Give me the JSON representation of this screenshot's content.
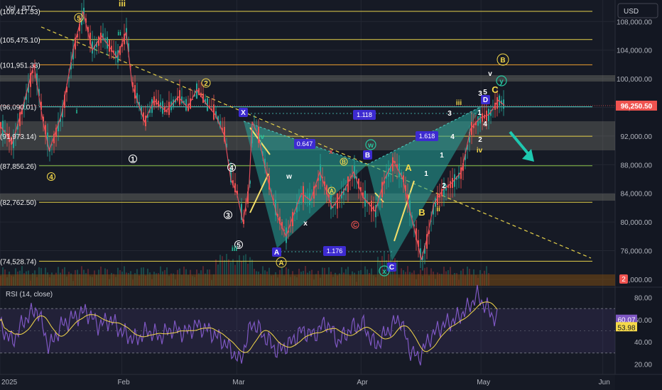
{
  "header": {
    "vol_label": "Vol · BTC",
    "currency_button": "USD"
  },
  "chart_data": [
    {
      "type": "line",
      "panel": "price",
      "x_ticks": [
        "2025",
        "Feb",
        "Mar",
        "Apr",
        "May",
        "Jun"
      ],
      "y_ticks": [
        72000,
        76000,
        80000,
        84000,
        88000,
        92000,
        96000,
        100000,
        104000,
        108000
      ],
      "ylim": [
        71000,
        111000
      ],
      "current_price": "96,250.50",
      "current_price_value": 96250.5,
      "countdown_badge": "2",
      "horizontal_levels": [
        {
          "label": "(109,417.53)",
          "value": 109417.53
        },
        {
          "label": "(105,475.10)",
          "value": 105475.1
        },
        {
          "label": "(101,951.33)",
          "value": 101951.33
        },
        {
          "label": "(96,090.01)",
          "value": 96090.01
        },
        {
          "label": "(91,973.14)",
          "value": 91973.14
        },
        {
          "label": "(87,856.26)",
          "value": 87856.26
        },
        {
          "label": "(82,762.50)",
          "value": 82762.5
        },
        {
          "label": "(74,528.74)",
          "value": 74528.74
        }
      ],
      "price_path": [
        [
          0,
          93500
        ],
        [
          0.02,
          91000
        ],
        [
          0.04,
          97000
        ],
        [
          0.055,
          102000
        ],
        [
          0.07,
          94000
        ],
        [
          0.08,
          90000
        ],
        [
          0.1,
          95000
        ],
        [
          0.12,
          104500
        ],
        [
          0.135,
          109400
        ],
        [
          0.15,
          104000
        ],
        [
          0.165,
          106000
        ],
        [
          0.19,
          103000
        ],
        [
          0.205,
          106500
        ],
        [
          0.215,
          99000
        ],
        [
          0.225,
          96500
        ],
        [
          0.235,
          94000
        ],
        [
          0.25,
          97000
        ],
        [
          0.27,
          95500
        ],
        [
          0.29,
          97500
        ],
        [
          0.305,
          96000
        ],
        [
          0.32,
          98500
        ],
        [
          0.335,
          96500
        ],
        [
          0.35,
          95000
        ],
        [
          0.365,
          92000
        ],
        [
          0.375,
          86000
        ],
        [
          0.385,
          84000
        ],
        [
          0.395,
          80000
        ],
        [
          0.405,
          85000
        ],
        [
          0.41,
          94000
        ],
        [
          0.42,
          92000
        ],
        [
          0.435,
          86000
        ],
        [
          0.45,
          81000
        ],
        [
          0.465,
          78000
        ],
        [
          0.475,
          80500
        ],
        [
          0.49,
          84000
        ],
        [
          0.505,
          83000
        ],
        [
          0.52,
          87000
        ],
        [
          0.54,
          82000
        ],
        [
          0.56,
          84500
        ],
        [
          0.575,
          87000
        ],
        [
          0.59,
          83500
        ],
        [
          0.61,
          81500
        ],
        [
          0.625,
          86000
        ],
        [
          0.64,
          88500
        ],
        [
          0.655,
          86000
        ],
        [
          0.665,
          82000
        ],
        [
          0.675,
          78500
        ],
        [
          0.685,
          74700
        ],
        [
          0.695,
          78000
        ],
        [
          0.705,
          82500
        ],
        [
          0.72,
          84500
        ],
        [
          0.735,
          85500
        ],
        [
          0.75,
          87000
        ],
        [
          0.765,
          93000
        ],
        [
          0.78,
          94500
        ],
        [
          0.795,
          95000
        ],
        [
          0.81,
          97000
        ],
        [
          0.82,
          96300
        ]
      ],
      "annotations": {
        "fib_ratios": [
          "1.118",
          "0.647",
          "1.618",
          "1.176"
        ],
        "pattern_points": [
          "X",
          "A",
          "B",
          "C",
          "D"
        ],
        "waves_yellow_circled": [
          "5",
          "4",
          "1",
          "2",
          "3",
          "4",
          "3",
          "4",
          "5",
          "A",
          "B",
          "C",
          "w",
          "y",
          "x",
          "B"
        ],
        "waves_plain": [
          "iii",
          "ii",
          "i",
          "iv",
          "w",
          "x",
          "iii",
          "iv",
          "v",
          "i",
          "ii",
          "1",
          "2",
          "3",
          "4",
          "5",
          "B",
          "C",
          "A",
          "y",
          "x",
          "v"
        ],
        "roman_counts": [
          "iii",
          "ii",
          "i",
          "iv",
          "iii",
          "ii",
          "iv"
        ],
        "arabic_counts": [
          "1",
          "2",
          "3",
          "4",
          "5"
        ]
      }
    },
    {
      "type": "line",
      "panel": "rsi",
      "title": "RSI (14, close)",
      "y_ticks": [
        20,
        40,
        60,
        80
      ],
      "ylim": [
        12,
        88
      ],
      "band": [
        30,
        70
      ],
      "rsi_value": "60.07",
      "rsi_ma_value": "53.98",
      "rsi_path": [
        [
          0,
          55
        ],
        [
          0.02,
          40
        ],
        [
          0.04,
          60
        ],
        [
          0.06,
          70
        ],
        [
          0.08,
          35
        ],
        [
          0.1,
          55
        ],
        [
          0.12,
          62
        ],
        [
          0.14,
          68
        ],
        [
          0.16,
          55
        ],
        [
          0.18,
          60
        ],
        [
          0.2,
          48
        ],
        [
          0.22,
          42
        ],
        [
          0.24,
          50
        ],
        [
          0.26,
          45
        ],
        [
          0.28,
          52
        ],
        [
          0.3,
          48
        ],
        [
          0.32,
          55
        ],
        [
          0.34,
          50
        ],
        [
          0.36,
          42
        ],
        [
          0.38,
          30
        ],
        [
          0.39,
          22
        ],
        [
          0.41,
          58
        ],
        [
          0.43,
          45
        ],
        [
          0.45,
          32
        ],
        [
          0.47,
          38
        ],
        [
          0.49,
          50
        ],
        [
          0.51,
          46
        ],
        [
          0.53,
          58
        ],
        [
          0.55,
          40
        ],
        [
          0.57,
          52
        ],
        [
          0.59,
          56
        ],
        [
          0.61,
          36
        ],
        [
          0.63,
          50
        ],
        [
          0.65,
          62
        ],
        [
          0.665,
          34
        ],
        [
          0.68,
          25
        ],
        [
          0.7,
          45
        ],
        [
          0.72,
          55
        ],
        [
          0.74,
          60
        ],
        [
          0.76,
          70
        ],
        [
          0.775,
          82
        ],
        [
          0.79,
          72
        ],
        [
          0.8,
          64
        ],
        [
          0.81,
          60
        ]
      ]
    }
  ]
}
